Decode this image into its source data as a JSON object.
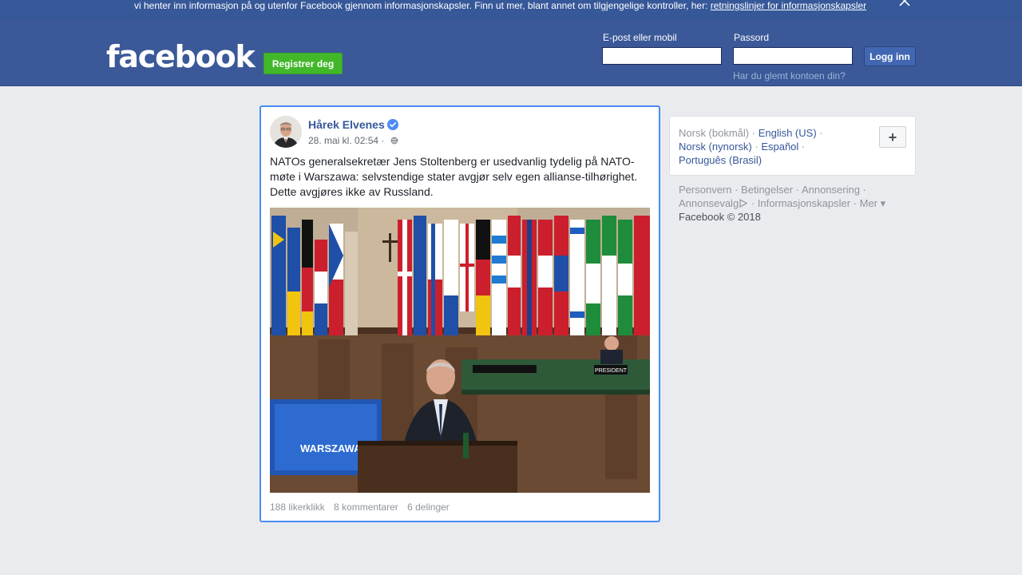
{
  "cookie_bar": {
    "text": "vi henter inn informasjon på og utenfor Facebook gjennom informasjonskapsler. Finn ut mer, blant annet om tilgjengelige kontroller, her: ",
    "link": "retningslinjer for informasjonskapsler"
  },
  "header": {
    "logo": "facebook",
    "register_label": "Registrer deg",
    "email_label": "E-post eller mobil",
    "email_value": "",
    "password_label": "Passord",
    "password_value": "",
    "login_label": "Logg inn",
    "forgot_label": "Har du glemt kontoen din?"
  },
  "post": {
    "author": "Hårek Elvenes",
    "timestamp": "28. mai kl. 02:54",
    "separator": " · ",
    "text": "NATOs generalsekretær Jens Stoltenberg er usedvanlig tydelig på NATO-møte i Warszawa: selvstendige stater avgjør selv egen allianse-tilhørighet. Dette avgjøres ikke av Russland.",
    "photo_screen_text": "WARSZAWA 2018",
    "photo_desk_label": "PRESIDENT",
    "stats": {
      "likes": "188 likerklikk",
      "comments": "8 kommentarer",
      "shares": "6 delinger"
    }
  },
  "languages": {
    "current": "Norsk (bokmål)",
    "options": [
      "English (US)",
      "Norsk (nynorsk)",
      "Español",
      "Português (Brasil)"
    ],
    "more_label": "+"
  },
  "footer": {
    "links": [
      "Personvern",
      "Betingelser",
      "Annonsering",
      "Annonsevalg",
      "Informasjonskapsler",
      "Mer"
    ],
    "copyright": "Facebook © 2018"
  },
  "colors": {
    "brand": "#3b5998",
    "cookie_bar": "#365899",
    "register_green": "#42b72a",
    "link_blue": "#365899",
    "focus_border": "#4c8bf5"
  }
}
